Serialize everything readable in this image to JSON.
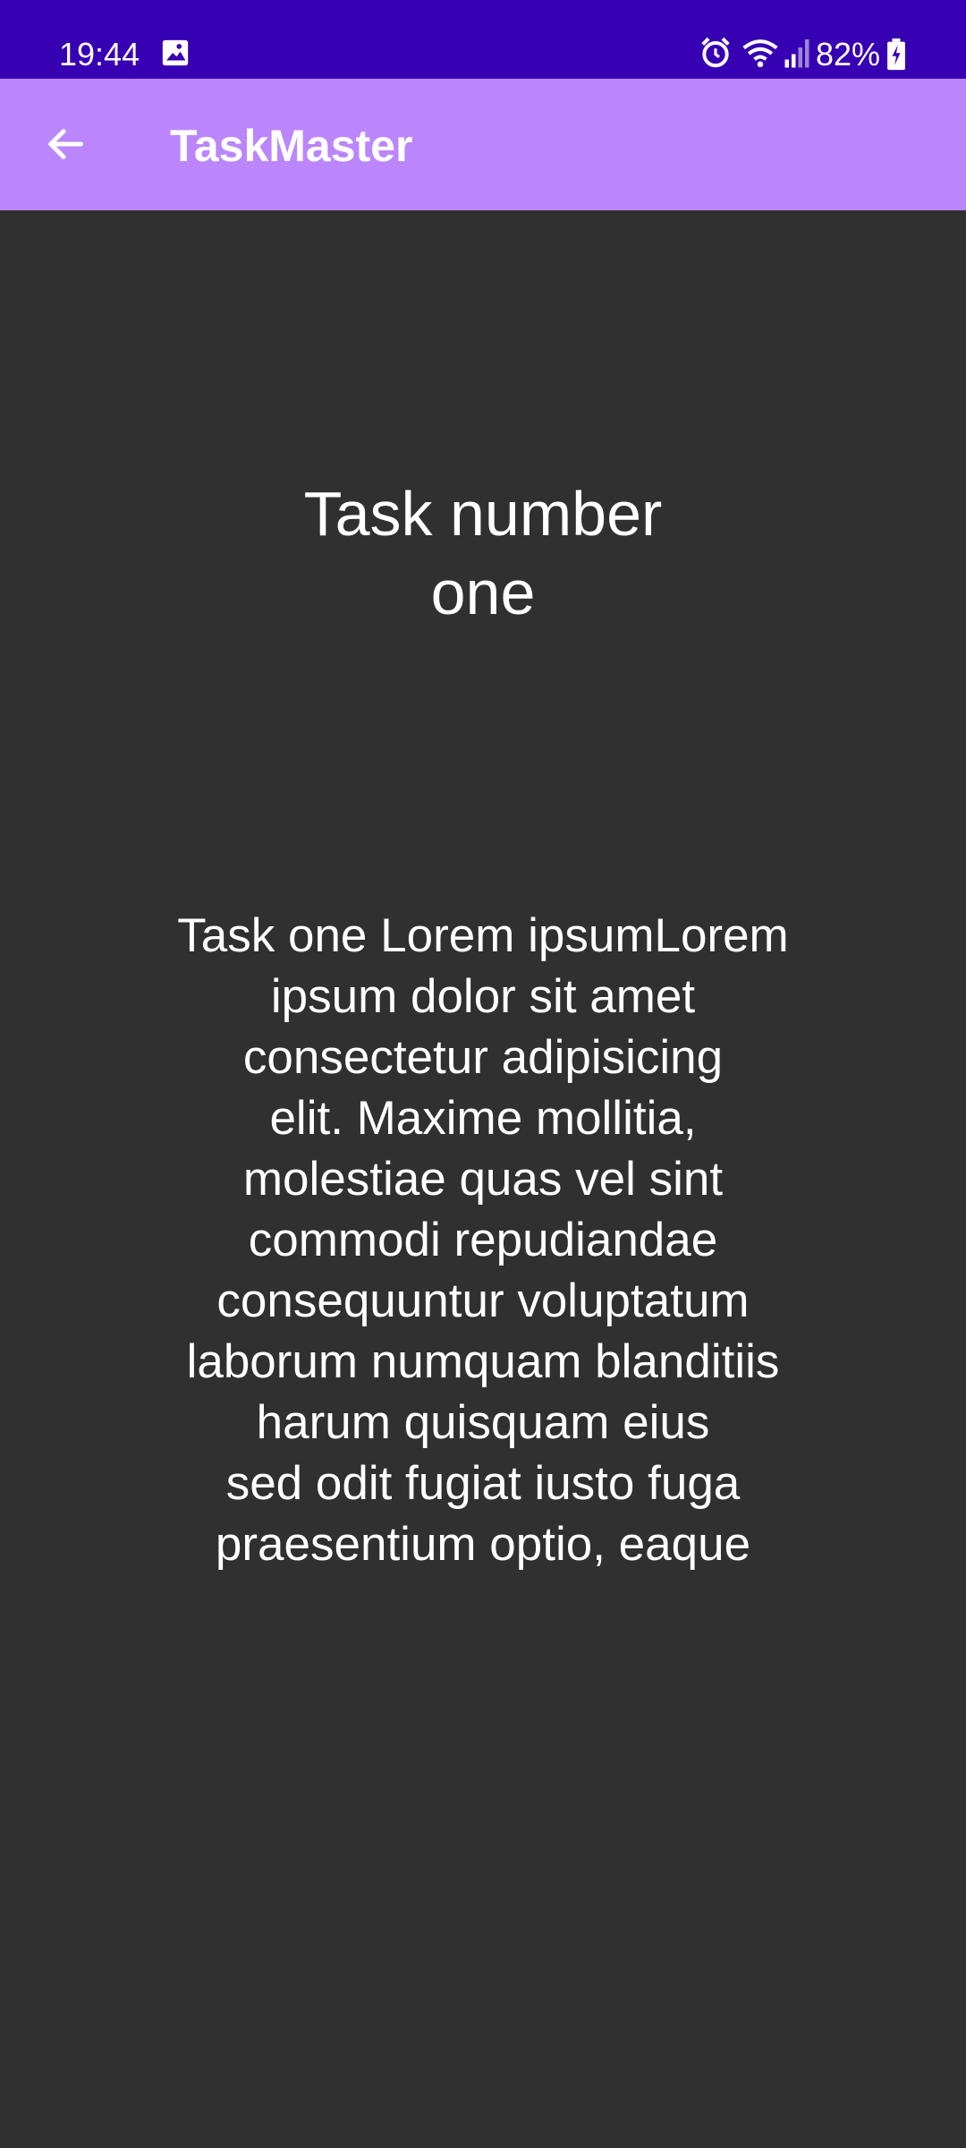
{
  "status_bar": {
    "time": "19:44",
    "battery_percent": "82%",
    "background_color": "#3700b3",
    "icons": [
      "gallery-icon",
      "alarm-icon",
      "wifi-icon",
      "signal-icon",
      "battery-charging-icon"
    ]
  },
  "app_bar": {
    "title": "TaskMaster",
    "back_icon": "arrow-back-icon",
    "background_color": "#bb86fc"
  },
  "task": {
    "title": "Task number\none",
    "description": "Task one Lorem ipsumLorem\nipsum dolor sit amet\nconsectetur adipisicing\nelit. Maxime mollitia,\nmolestiae quas vel sint\ncommodi repudiandae\nconsequuntur voluptatum\nlaborum numquam blanditiis\nharum quisquam eius\nsed odit fugiat iusto fuga\npraesentium optio, eaque"
  },
  "page": {
    "background_color": "#303030"
  }
}
